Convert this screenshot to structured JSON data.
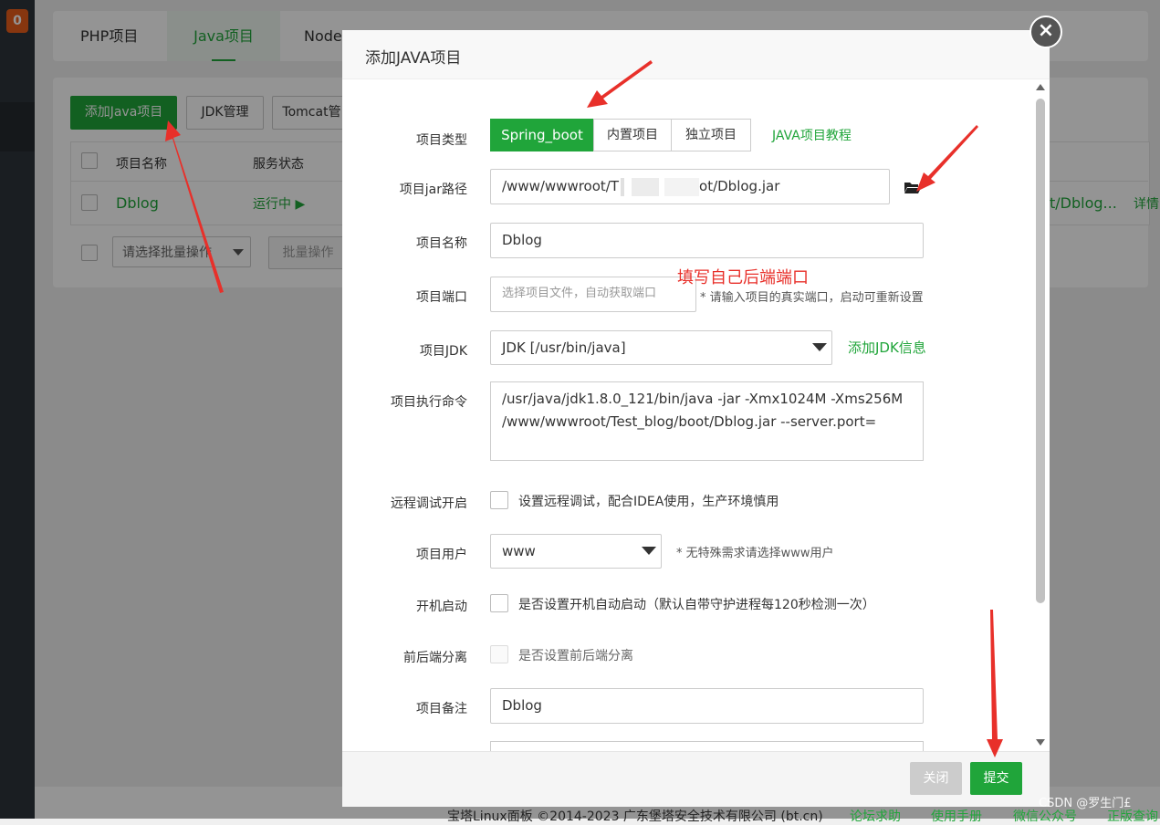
{
  "sidebar": {
    "badge": "0"
  },
  "tabs": [
    "PHP项目",
    "Java项目",
    "Node"
  ],
  "toolbar": {
    "add_java": "添加Java项目",
    "jdk_manage": "JDK管理",
    "tomcat": "Tomcat管"
  },
  "table": {
    "headers": [
      "项目名称",
      "服务状态"
    ],
    "row": {
      "name": "Dblog",
      "status": "运行中 ▶",
      "path": "t/Dblog...",
      "detail": "详情"
    }
  },
  "batch": {
    "select_placeholder": "请选择批量操作",
    "batch_button": "批量操作"
  },
  "footer": {
    "copyright": "宝塔Linux面板 ©2014-2023 广东堡塔安全技术有限公司 (bt.cn)",
    "links": [
      "论坛求助",
      "使用手册",
      "微信公众号",
      "正版查询"
    ]
  },
  "watermark": "CSDN @罗生门£",
  "modal": {
    "title": "添加JAVA项目",
    "close_icon": "close-icon",
    "project_type": {
      "label": "项目类型",
      "options": [
        "Spring_boot",
        "内置项目",
        "独立项目"
      ],
      "selected": "Spring_boot",
      "tutorial": "JAVA项目教程"
    },
    "jar_path": {
      "label": "项目jar路径",
      "value_prefix": "/www/wwwroot/T",
      "value_suffix": "ot/Dblog.jar",
      "icon": "folder-open-icon"
    },
    "name": {
      "label": "项目名称",
      "value": "Dblog"
    },
    "port": {
      "label": "项目端口",
      "placeholder": "选择项目文件，自动获取端口",
      "hint": "* 请输入项目的真实端口，启动可重新设置"
    },
    "jdk": {
      "label": "项目JDK",
      "value": "JDK [/usr/bin/java]",
      "add": "添加JDK信息"
    },
    "command": {
      "label": "项目执行命令",
      "line1": "/usr/java/jdk1.8.0_121/bin/java -jar -Xmx1024M -Xms256M",
      "line2": "/www/wwwroot/Test_blog/boot/Dblog.jar --server.port="
    },
    "remote_debug": {
      "label": "远程调试开启",
      "text": "设置远程调试，配合IDEA使用，生产环境慎用"
    },
    "user": {
      "label": "项目用户",
      "value": "www",
      "hint": "* 无特殊需求请选择www用户"
    },
    "autostart": {
      "label": "开机启动",
      "text": "是否设置开机自动启动（默认自带守护进程每120秒检测一次）"
    },
    "separation": {
      "label": "前后端分离",
      "text": "是否设置前后端分离"
    },
    "remark": {
      "label": "项目备注",
      "value": "Dblog"
    },
    "buttons": {
      "close": "关闭",
      "submit": "提交"
    }
  },
  "annotation": {
    "text": "填写自己后端端口",
    "color": "#e8302a"
  }
}
